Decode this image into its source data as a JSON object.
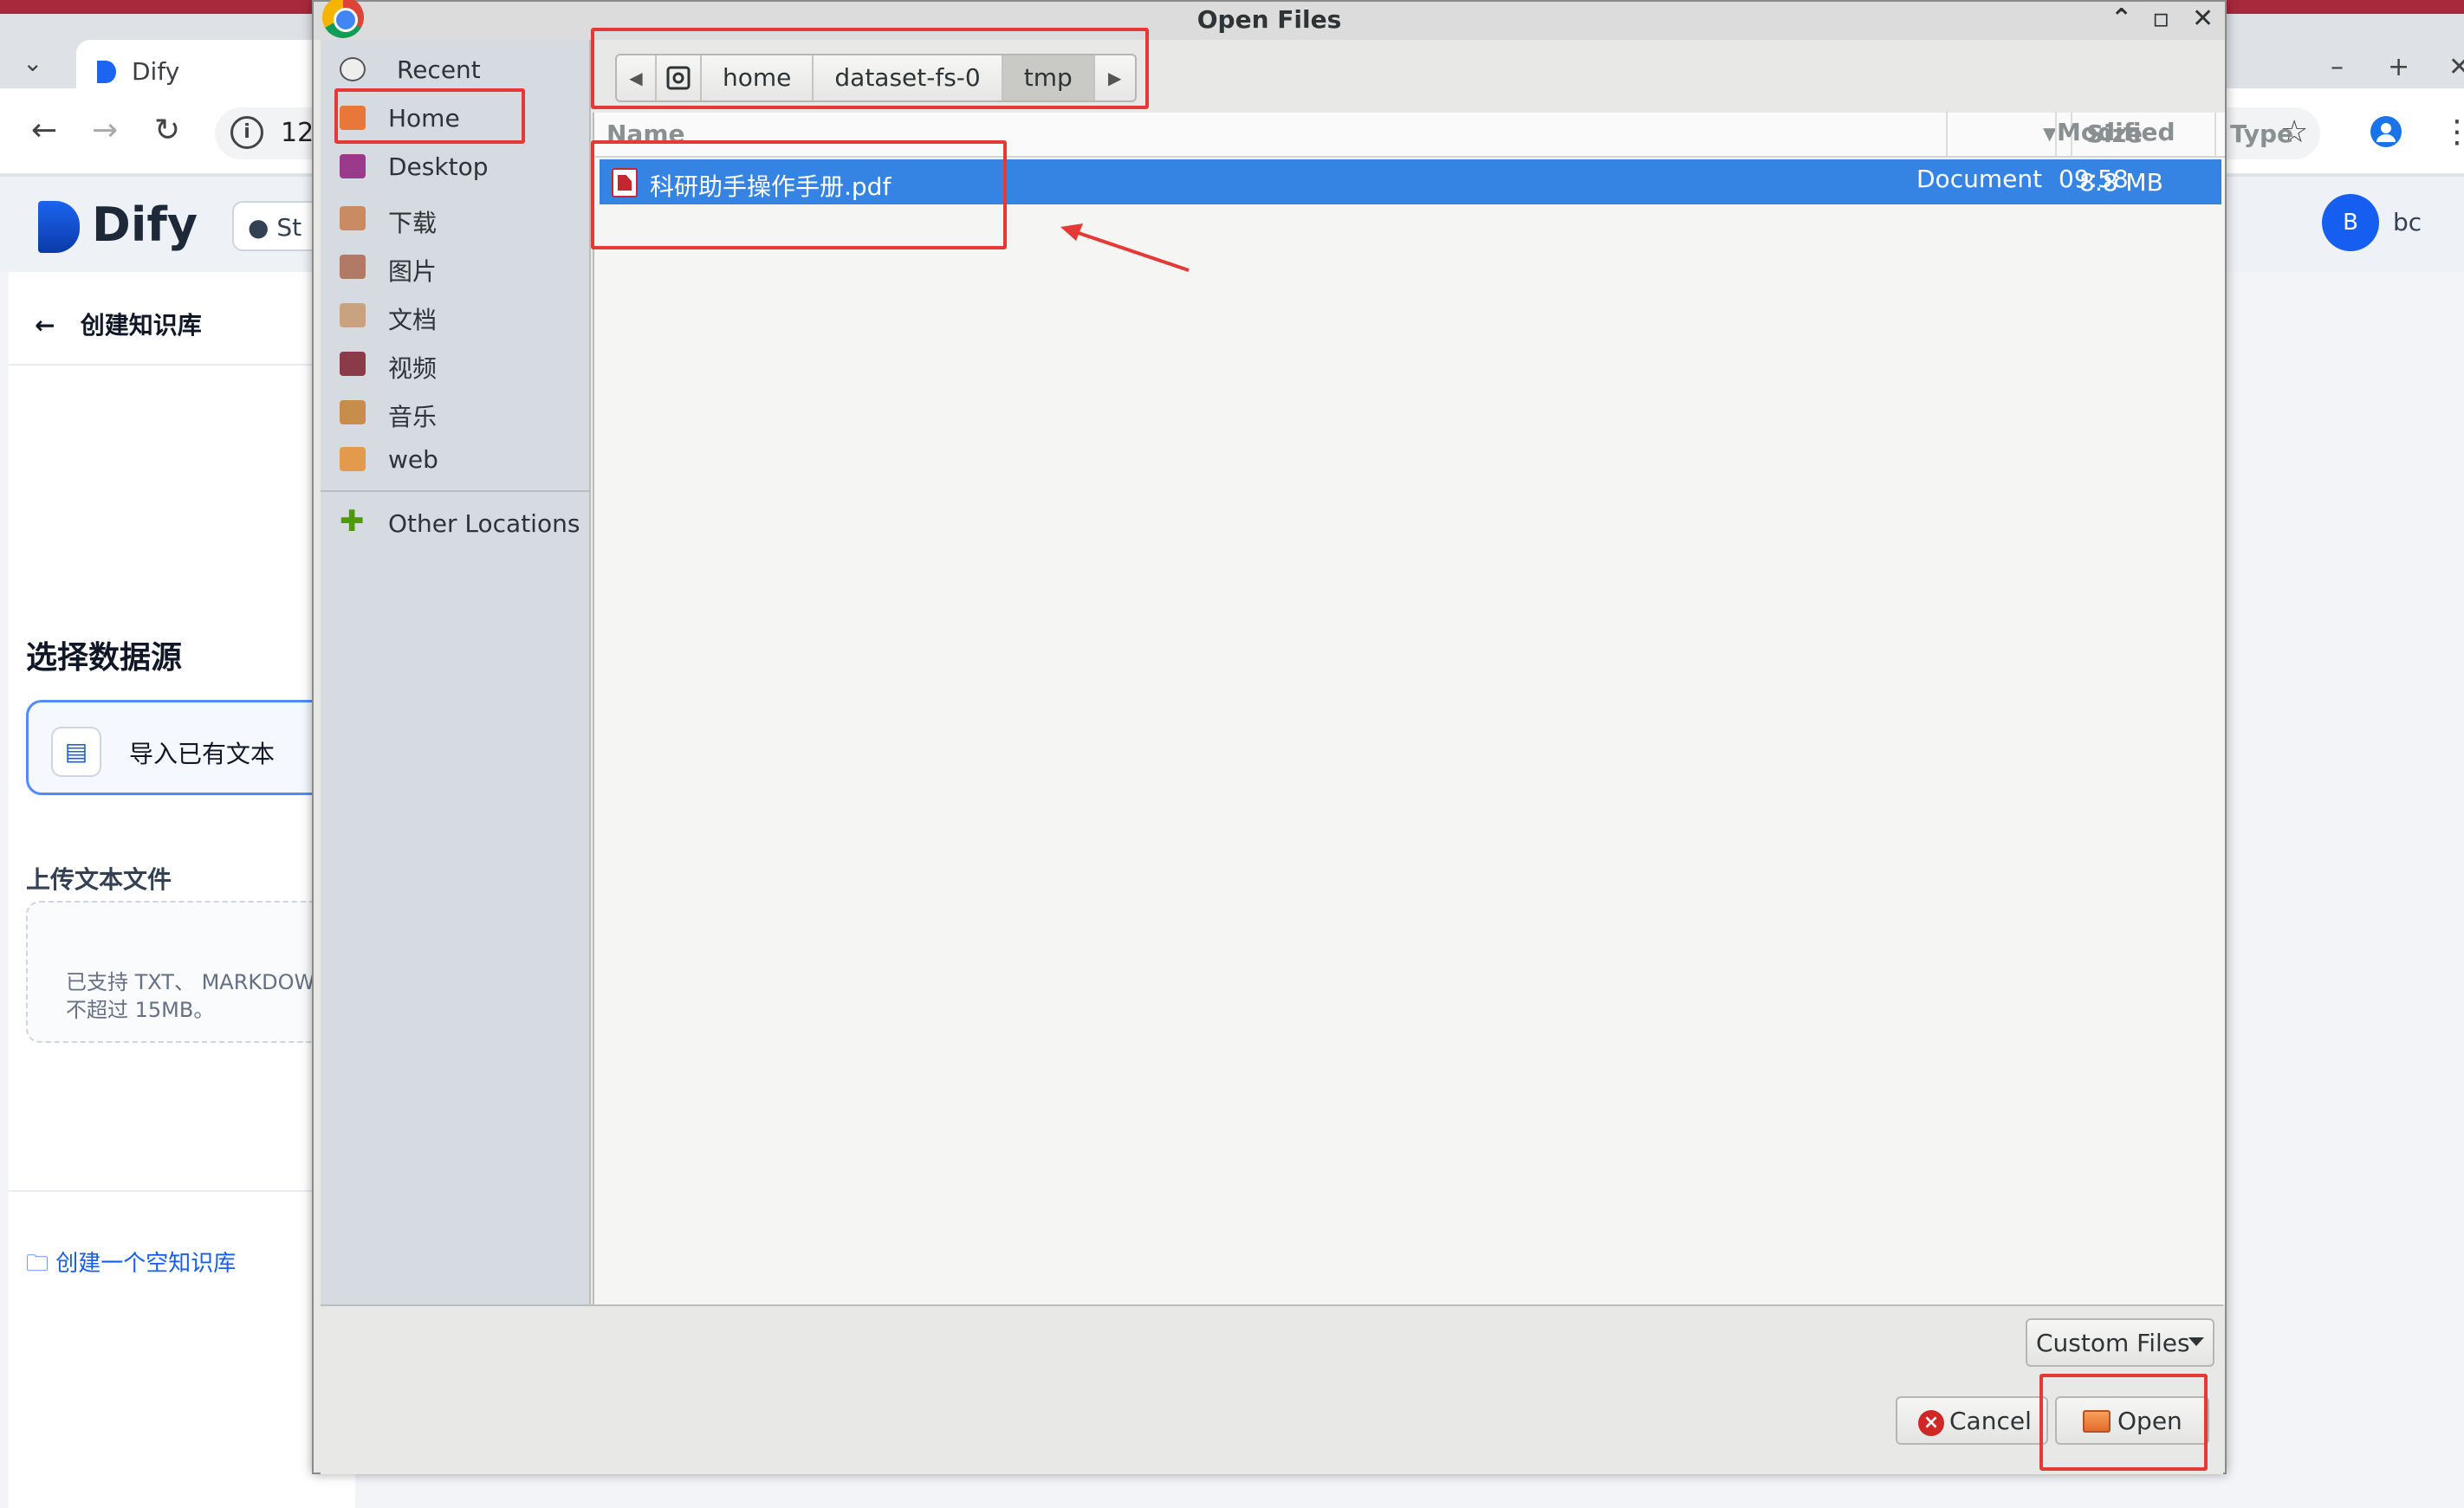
{
  "browser": {
    "tab_title": "Dify",
    "url_fragment": "12",
    "colors": {
      "tab_accent": "#a8293c",
      "chrome_bg": "#dee1e6"
    }
  },
  "dify": {
    "logo_text": "Dify",
    "github_label": "St",
    "avatar_letter": "B",
    "user_name": "bc",
    "back_label": "创建知识库",
    "section_title": "选择数据源",
    "source_option": "导入已有文本",
    "upload_title": "上传文本文件",
    "upload_hint_1": "已支持 TXT、 MARKDOWN",
    "upload_hint_2": "不超过 15MB。",
    "empty_kb_link": "创建一个空知识库",
    "accent": "#155eef"
  },
  "dialog": {
    "title": "Open Files",
    "places": [
      {
        "label": "Recent",
        "icon": "clock-icon"
      },
      {
        "label": "Home",
        "icon": "home-folder-icon"
      },
      {
        "label": "Desktop",
        "icon": "desktop-icon"
      },
      {
        "label": "下载",
        "icon": "download-folder-icon"
      },
      {
        "label": "图片",
        "icon": "pictures-folder-icon"
      },
      {
        "label": "文档",
        "icon": "documents-folder-icon"
      },
      {
        "label": "视频",
        "icon": "videos-folder-icon"
      },
      {
        "label": "音乐",
        "icon": "music-folder-icon"
      },
      {
        "label": "web",
        "icon": "folder-icon"
      },
      {
        "label": "Other Locations",
        "icon": "plus-icon"
      }
    ],
    "path": [
      "home",
      "dataset-fs-0",
      "tmp"
    ],
    "columns": {
      "name": "Name",
      "size": "Size",
      "type": "Type",
      "modified": "Modified"
    },
    "files": [
      {
        "name": "科研助手操作手册.pdf",
        "size": "8.8 MB",
        "type": "Document",
        "modified": "09:58",
        "selected": true
      }
    ],
    "filter": "Custom Files",
    "cancel_label": "Cancel",
    "open_label": "Open",
    "selection_color": "#3584e4",
    "annotation_color": "#e53935"
  }
}
